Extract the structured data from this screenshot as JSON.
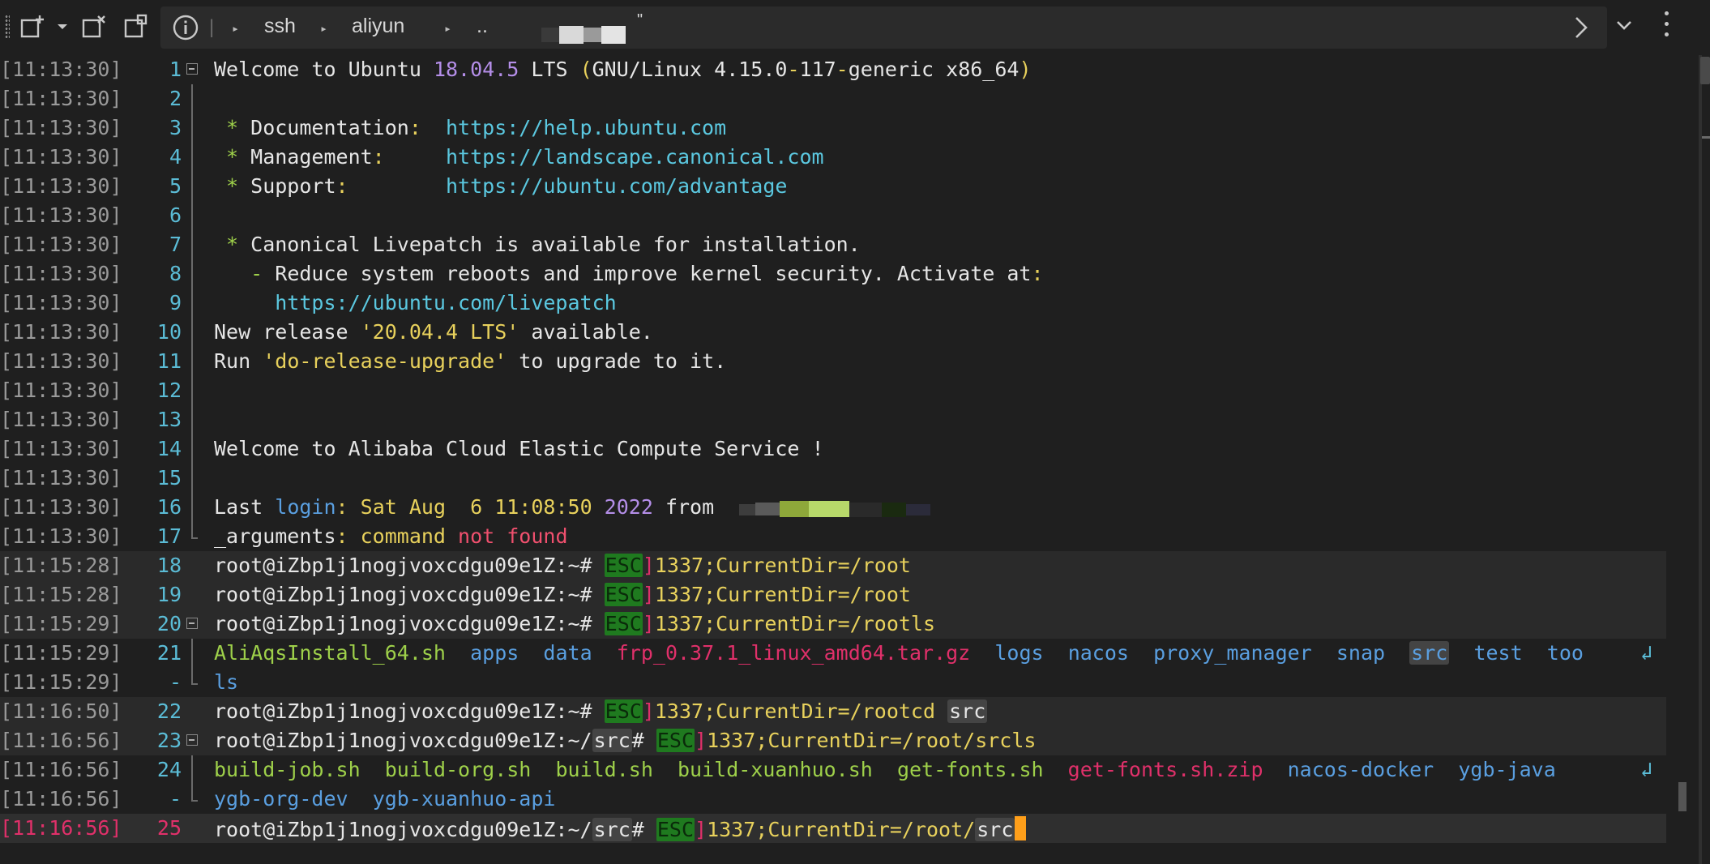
{
  "toolbar": {
    "breadcrumb": [
      "ssh",
      "aliyun",
      ".."
    ],
    "trailing_mark": "\""
  },
  "terminal": {
    "lines": [
      {
        "ts": "[11:13:30]",
        "ln": "1"
      },
      {
        "ts": "[11:13:30]",
        "ln": "2"
      },
      {
        "ts": "[11:13:30]",
        "ln": "3"
      },
      {
        "ts": "[11:13:30]",
        "ln": "4"
      },
      {
        "ts": "[11:13:30]",
        "ln": "5"
      },
      {
        "ts": "[11:13:30]",
        "ln": "6"
      },
      {
        "ts": "[11:13:30]",
        "ln": "7"
      },
      {
        "ts": "[11:13:30]",
        "ln": "8"
      },
      {
        "ts": "[11:13:30]",
        "ln": "9"
      },
      {
        "ts": "[11:13:30]",
        "ln": "10"
      },
      {
        "ts": "[11:13:30]",
        "ln": "11"
      },
      {
        "ts": "[11:13:30]",
        "ln": "12"
      },
      {
        "ts": "[11:13:30]",
        "ln": "13"
      },
      {
        "ts": "[11:13:30]",
        "ln": "14"
      },
      {
        "ts": "[11:13:30]",
        "ln": "15"
      },
      {
        "ts": "[11:13:30]",
        "ln": "16"
      },
      {
        "ts": "[11:13:30]",
        "ln": "17"
      },
      {
        "ts": "[11:15:28]",
        "ln": "18"
      },
      {
        "ts": "[11:15:28]",
        "ln": "19"
      },
      {
        "ts": "[11:15:29]",
        "ln": "20"
      },
      {
        "ts": "[11:15:29]",
        "ln": "21"
      },
      {
        "ts": "[11:15:29]",
        "ln": "-"
      },
      {
        "ts": "[11:16:50]",
        "ln": "22"
      },
      {
        "ts": "[11:16:56]",
        "ln": "23"
      },
      {
        "ts": "[11:16:56]",
        "ln": "24"
      },
      {
        "ts": "[11:16:56]",
        "ln": "-"
      },
      {
        "ts": "[11:16:56]",
        "ln": "25"
      }
    ],
    "text": {
      "welcome_prefix": "Welcome to Ubuntu ",
      "ubuntu_version": "18.04.5",
      "lts": " LTS ",
      "paren_open": "(",
      "kernel_a": "GNU/Linux 4.15.0",
      "dash1": "-",
      "kernel_b": "117",
      "dash2": "-",
      "kernel_c": "generic x86_64",
      "paren_close": ")",
      "star": " * ",
      "doc_label": "Documentation",
      "doc_colon": ":  ",
      "doc_url": "https://help.ubuntu.com",
      "mgmt_label": "Management",
      "mgmt_colon": ":     ",
      "mgmt_url": "https://landscape.canonical.com",
      "sup_label": "Support",
      "sup_colon": ":        ",
      "sup_url": "https://ubuntu.com/advantage",
      "livepatch": "Canonical Livepatch is available for installation.",
      "reduce_dash": "   - ",
      "reduce_text": "Reduce system reboots and improve kernel security. Activate at",
      "reduce_colon": ":",
      "livepatch_url": "     https://ubuntu.com/livepatch",
      "release_a": "New release ",
      "release_b": "'20.04.4 LTS'",
      "release_c": " available.",
      "run_a": "Run ",
      "run_b": "'do-release-upgrade'",
      "run_c": " to upgrade to it.",
      "alibaba": "Welcome to Alibaba Cloud Elastic Compute Service !",
      "last_a": "Last ",
      "last_login": "login",
      "last_colon": ": ",
      "last_date": "Sat Aug  6 11:08:50 ",
      "last_year": "2022",
      "last_from": " from ",
      "args_a": "_arguments",
      "args_b": ": command ",
      "args_c": "not found",
      "prompt_root": "root@iZbp1j1nogjvoxcdgu09e1Z:~# ",
      "prompt_src_a": "root@iZbp1j1nogjvoxcdgu09e1Z:~/",
      "src": "src",
      "hash": "# ",
      "esc": "ESC",
      "br": "]",
      "cd_root": "1337;CurrentDir=/root",
      "cd_rootls": "1337;CurrentDir=/rootls",
      "cd_rootcd": "1337;CurrentDir=/rootcd ",
      "cd_srcls": "1337;CurrentDir=/root/srcls",
      "cd_src_a": "1337;CurrentDir=/root/",
      "ls_root": [
        "AliAqsInstall_64.sh",
        "apps",
        "data",
        "frp_0.37.1_linux_amd64.tar.gz",
        "logs",
        "nacos",
        "proxy_manager",
        "snap",
        "src",
        "test",
        "too"
      ],
      "ls_root_wrap": "ls",
      "ls_src": [
        "build-job.sh",
        "build-org.sh",
        "build.sh",
        "build-xuanhuo.sh",
        "get-fonts.sh",
        "get-fonts.sh.zip",
        "nacos-docker",
        "ygb-java"
      ],
      "ls_src_wrap": [
        "ygb-org-dev",
        "ygb-xuanhuo-api"
      ],
      "wrap_glyph": "↲"
    }
  }
}
